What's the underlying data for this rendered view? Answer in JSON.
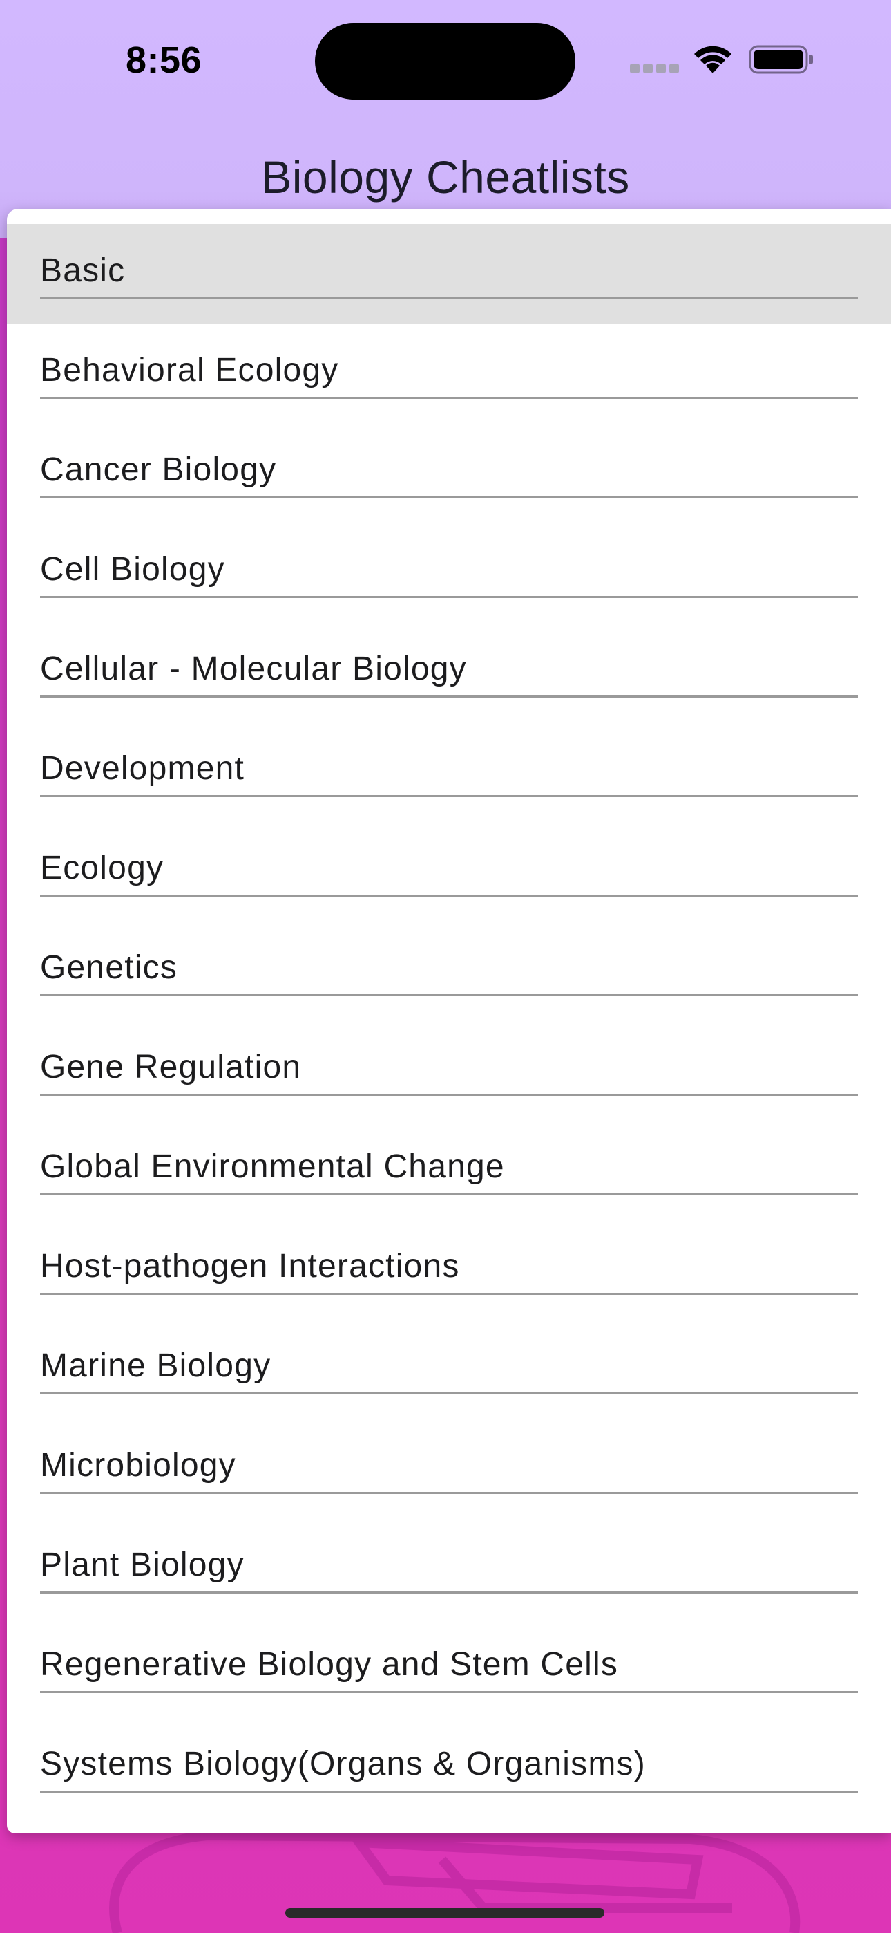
{
  "status_bar": {
    "time": "8:56"
  },
  "header": {
    "title": "Biology Cheatlists"
  },
  "list": {
    "selected_index": 0,
    "items": [
      {
        "label": "Basic"
      },
      {
        "label": "Behavioral Ecology"
      },
      {
        "label": "Cancer Biology"
      },
      {
        "label": "Cell Biology"
      },
      {
        "label": "Cellular - Molecular Biology"
      },
      {
        "label": "Development"
      },
      {
        "label": "Ecology"
      },
      {
        "label": "Genetics"
      },
      {
        "label": "Gene Regulation"
      },
      {
        "label": "Global Environmental Change"
      },
      {
        "label": "Host-pathogen Interactions"
      },
      {
        "label": "Marine Biology"
      },
      {
        "label": "Microbiology"
      },
      {
        "label": "Plant Biology"
      },
      {
        "label": "Regenerative Biology and Stem Cells"
      },
      {
        "label": "Systems Biology(Organs & Organisms)"
      }
    ]
  },
  "colors": {
    "header_background": "#d2b8ff",
    "page_background": "#d23ab4",
    "selected_row": "#e0e0e0",
    "divider": "#9a9a9a"
  },
  "icons": [
    "wifi-icon",
    "battery-icon",
    "cellular-signal-icon"
  ]
}
